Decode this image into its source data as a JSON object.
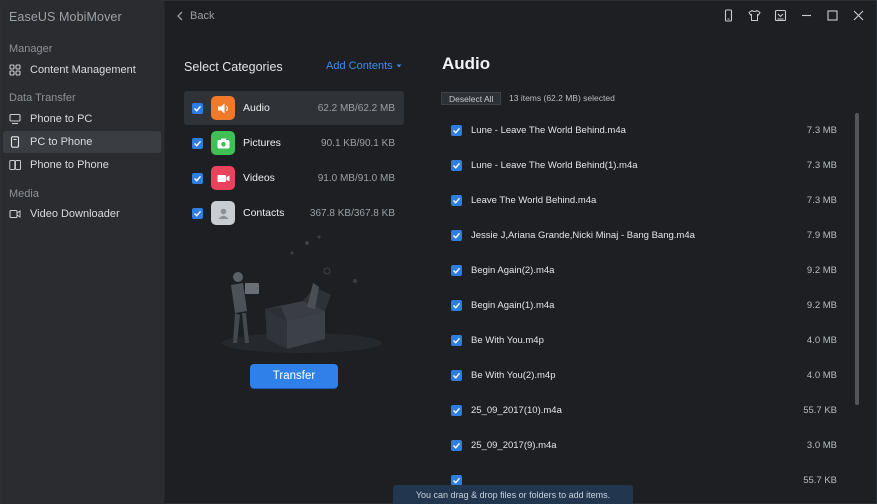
{
  "app": {
    "title": "EaseUS MobiMover"
  },
  "sidebar": {
    "sections": [
      {
        "label": "Manager",
        "items": [
          {
            "label": "Content Management",
            "icon": "grid-icon",
            "active": false
          }
        ]
      },
      {
        "label": "Data Transfer",
        "items": [
          {
            "label": "Phone to PC",
            "icon": "phone-to-pc-icon",
            "active": false
          },
          {
            "label": "PC to Phone",
            "icon": "pc-to-phone-icon",
            "active": true
          },
          {
            "label": "Phone to Phone",
            "icon": "phone-to-phone-icon",
            "active": false
          }
        ]
      },
      {
        "label": "Media",
        "items": [
          {
            "label": "Video Downloader",
            "icon": "video-download-icon",
            "active": false
          }
        ]
      }
    ]
  },
  "topbar": {
    "back_label": "Back",
    "controls": [
      "device-icon",
      "shirt-icon",
      "dropdown-box-icon",
      "minimize-icon",
      "maximize-icon",
      "close-icon"
    ]
  },
  "categories": {
    "title": "Select Categories",
    "add_contents_label": "Add Contents",
    "items": [
      {
        "name": "Audio",
        "size": "62.2 MB/62.2 MB",
        "color": "#f07a2a",
        "icon": "speaker-icon",
        "checked": true,
        "active": true
      },
      {
        "name": "Pictures",
        "size": "90.1 KB/90.1 KB",
        "color": "#3fbf55",
        "icon": "camera-icon",
        "checked": true,
        "active": false
      },
      {
        "name": "Videos",
        "size": "91.0 MB/91.0 MB",
        "color": "#e8425f",
        "icon": "video-icon",
        "checked": true,
        "active": false
      },
      {
        "name": "Contacts",
        "size": "367.8 KB/367.8 KB",
        "color": "#c9ccd0",
        "icon": "contact-icon",
        "checked": true,
        "active": false
      }
    ],
    "transfer_label": "Transfer"
  },
  "files": {
    "title": "Audio",
    "deselect_label": "Deselect All",
    "selected_info": "13 items (62.2 MB) selected",
    "items": [
      {
        "name": "Lune - Leave The World Behind.m4a",
        "size": "7.3 MB"
      },
      {
        "name": "Lune - Leave The World Behind(1).m4a",
        "size": "7.3 MB"
      },
      {
        "name": "Leave The World Behind.m4a",
        "size": "7.3 MB"
      },
      {
        "name": "Jessie J,Ariana Grande,Nicki Minaj - Bang Bang.m4a",
        "size": "7.9 MB"
      },
      {
        "name": "Begin Again(2).m4a",
        "size": "9.2 MB"
      },
      {
        "name": "Begin Again(1).m4a",
        "size": "9.2 MB"
      },
      {
        "name": "Be With You.m4p",
        "size": "4.0 MB"
      },
      {
        "name": "Be With You(2).m4p",
        "size": "4.0 MB"
      },
      {
        "name": "25_09_2017(10).m4a",
        "size": "55.7 KB"
      },
      {
        "name": "25_09_2017(9).m4a",
        "size": "3.0 MB"
      },
      {
        "name": "",
        "size": "55.7 KB"
      }
    ],
    "drop_hint": "You can drag & drop files or folders to add items."
  }
}
